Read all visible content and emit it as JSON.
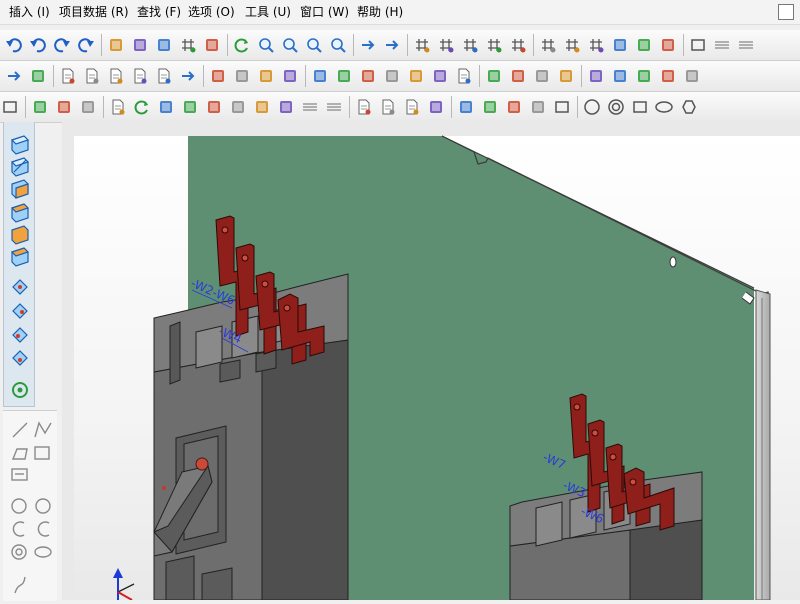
{
  "menu": [
    {
      "label": "插入 (I)"
    },
    {
      "label": "项目数据 (R)"
    },
    {
      "label": "查找 (F)"
    },
    {
      "label": "选项 (O)"
    },
    {
      "label": "工具 (U)"
    },
    {
      "label": "窗口 (W)"
    },
    {
      "label": "帮助 (H)"
    }
  ],
  "toolbar_icons": {
    "row1": [
      "undo-icon",
      "undo-step-icon",
      "redo-icon",
      "redo-step-icon",
      "view-layout-icon",
      "properties-icon",
      "checklist-icon",
      "grid-table-icon",
      "window-icon",
      "refresh-icon",
      "zoom-window-icon",
      "zoom-in-icon",
      "zoom-out-icon",
      "zoom-100-icon",
      "back-arrow-icon",
      "forward-arrow-icon",
      "grid-a-icon",
      "grid-b-icon",
      "grid-c-icon",
      "grid-d-icon",
      "grid-e-icon",
      "grid-icon",
      "snap-grid-icon",
      "snap-point-icon",
      "magnet-icon",
      "node-network-icon",
      "counter-icon",
      "rectangle-icon",
      "lines-icon",
      "lines-alt-icon"
    ],
    "row2": [
      "arrow-right-icon",
      "cursor-x-icon",
      "doc-icon",
      "doc-new-icon",
      "doc-check-icon",
      "doc-star-icon",
      "doc-swap-icon",
      "doc-arrow-icon",
      "gears-icon",
      "table-icon",
      "layers-icon",
      "stack-icon",
      "component-icon",
      "flow-icon",
      "tree-icon",
      "tree-alt-icon",
      "folder-icon",
      "db-icon",
      "doc-lines-icon",
      "wave-icon",
      "diode-icon",
      "pin-icon",
      "dots-icon",
      "ruler-icon",
      "cross-icon",
      "tool-icon",
      "cursor-icon",
      "cursor-alt-icon"
    ],
    "row3": [
      "box-3d-icon",
      "filter-icon",
      "cube-icon",
      "device-icon",
      "clipboard-icon",
      "rotate-icon",
      "sparkle-icon",
      "pin-orange-icon",
      "bend-icon",
      "bend-alt-icon",
      "bend-x-icon",
      "distance-icon",
      "hatch-icon",
      "hatch-alt-icon",
      "page-icon",
      "page-alt-icon",
      "page-dark-icon",
      "axis-icon",
      "diamond-icon",
      "sym-a-icon",
      "sym-b-icon",
      "sym-c-icon",
      "box-icon",
      "circle-icon",
      "circle-ring-icon",
      "square-icon",
      "ellipse-icon",
      "hexagon-icon"
    ]
  },
  "viewport": {
    "wire_labels": [
      "-W2-W6",
      "-W4",
      "-W7",
      "-W3",
      "-W6"
    ]
  },
  "colors": {
    "panel_green": "#5f8f73",
    "busbar_red": "#8e1f1a",
    "breaker_gray": "#6b6b6b",
    "label_blue": "#2a3bd6"
  }
}
